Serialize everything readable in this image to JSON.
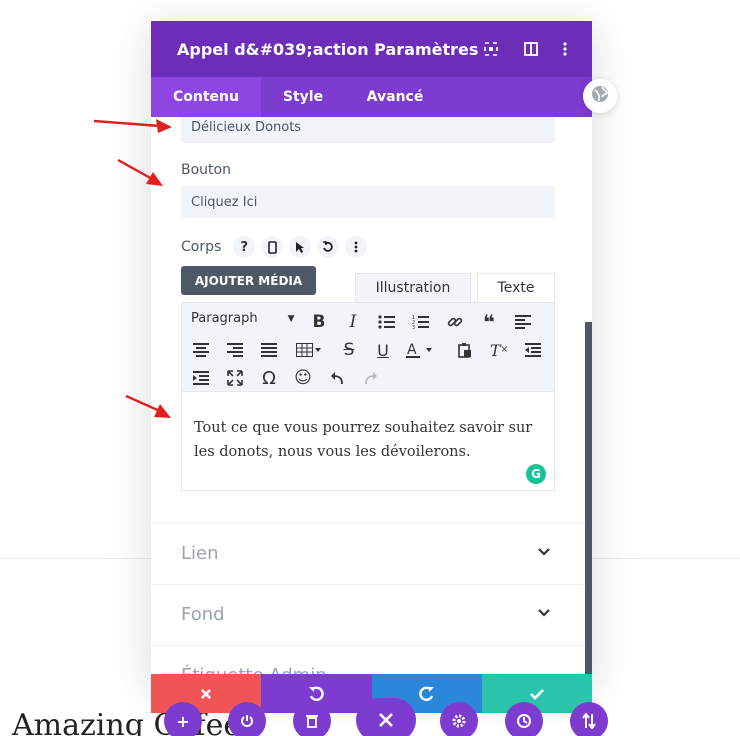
{
  "modal": {
    "title": "Appel d&#039;action Paramètres",
    "tabs": [
      "Contenu",
      "Style",
      "Avancé"
    ],
    "active_tab": "Contenu"
  },
  "fields": {
    "title_value": "Délicieux Donots",
    "button_label": "Bouton",
    "button_value": "Cliquez Ici",
    "body_label": "Corps"
  },
  "editor": {
    "media_button": "AJOUTER MÉDIA",
    "tab_visual": "Illustration",
    "tab_text": "Texte",
    "format_select": "Paragraph",
    "content": "Tout ce que vous pourrez souhaitez savoir sur les donots, nous vous les dévoilerons."
  },
  "sections": [
    "Lien",
    "Fond",
    "Étiquette Admin"
  ],
  "background": {
    "heading": "Amazing Cofee"
  },
  "colors": {
    "header_purple": "#6c2eb9",
    "tabs_purple": "#7e3bd0",
    "cancel_red": "#ef5555",
    "undo_purple": "#7e3bd0",
    "redo_blue": "#2b87da",
    "save_green": "#29c4a9"
  }
}
